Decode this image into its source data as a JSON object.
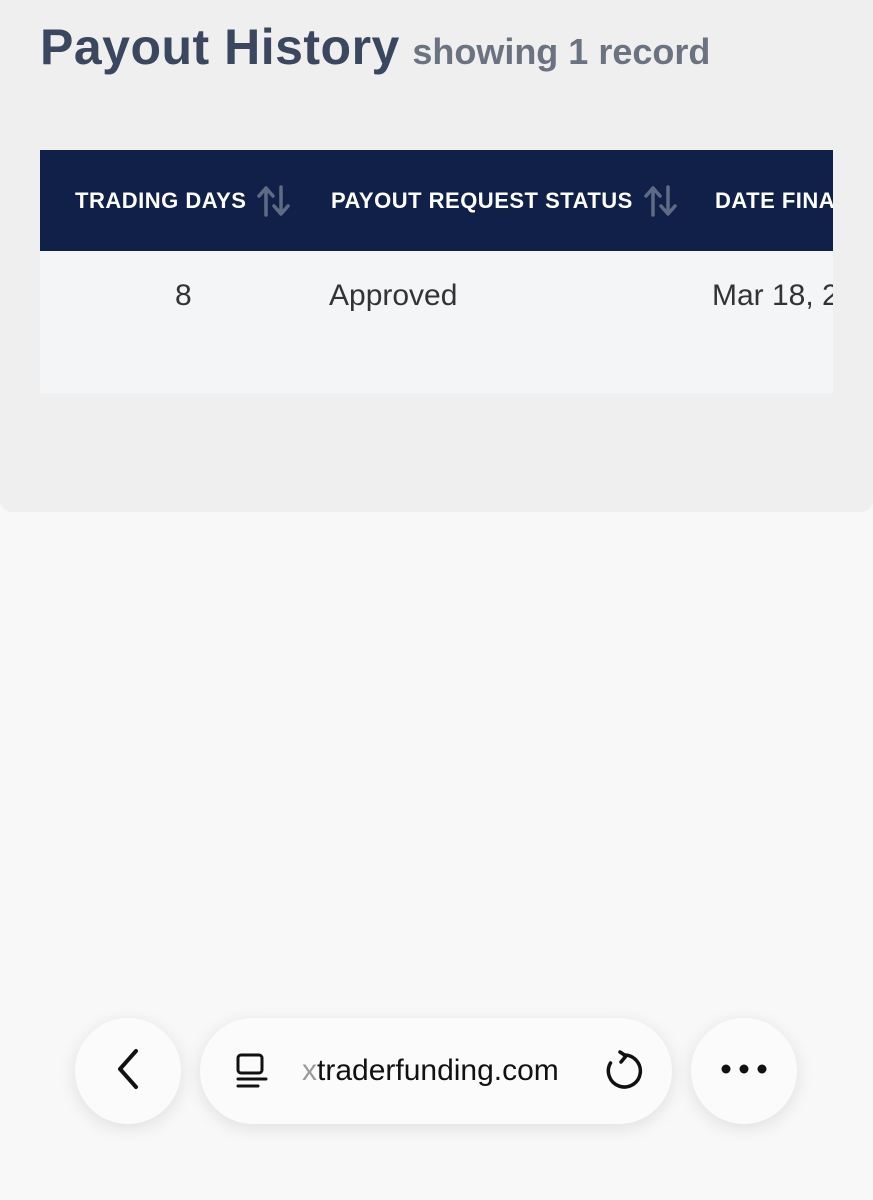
{
  "header": {
    "title": "Payout History",
    "record_count": "showing 1 record"
  },
  "table": {
    "columns": [
      {
        "label": "TRADING DAYS",
        "sortable": true
      },
      {
        "label": "PAYOUT REQUEST STATUS",
        "sortable": true
      },
      {
        "label": "DATE FINA",
        "sortable": false
      }
    ],
    "rows": [
      {
        "trading_days": "8",
        "status": "Approved",
        "date": "Mar 18, 2"
      }
    ]
  },
  "browser": {
    "url_first_char": "x",
    "url_rest": "traderfunding.com",
    "icons": {
      "back": "chevron-left-icon",
      "reader": "reader-mode-icon",
      "reload": "reload-icon",
      "more": "more-dots-icon"
    }
  },
  "colors": {
    "header_bg": "#112048",
    "title": "#3a475e",
    "subtitle": "#6b7280",
    "row_bg": "#f4f5f7"
  }
}
